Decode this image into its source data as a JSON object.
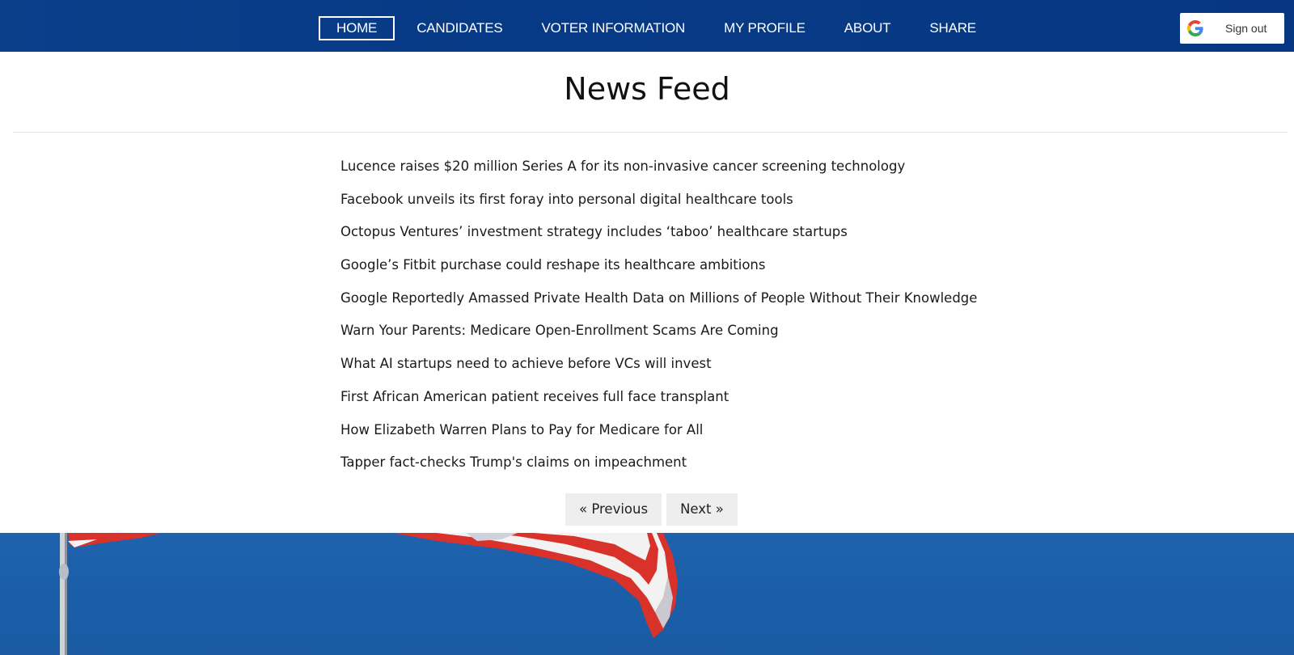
{
  "nav": {
    "items": [
      {
        "label": "HOME",
        "active": true
      },
      {
        "label": "CANDIDATES",
        "active": false
      },
      {
        "label": "VOTER INFORMATION",
        "active": false
      },
      {
        "label": "MY PROFILE",
        "active": false
      },
      {
        "label": "ABOUT",
        "active": false
      },
      {
        "label": "SHARE",
        "active": false
      }
    ],
    "signout": {
      "label": "Sign out",
      "icon": "google-icon"
    }
  },
  "main": {
    "title": "News Feed",
    "news": [
      "Lucence raises $20 million Series A for its non-invasive cancer screening technology",
      "Facebook unveils its first foray into personal digital healthcare tools",
      "Octopus Ventures’ investment strategy includes ‘taboo’ healthcare startups",
      "Google’s Fitbit purchase could reshape its healthcare ambitions",
      "Google Reportedly Amassed Private Health Data on Millions of People Without Their Knowledge",
      "Warn Your Parents: Medicare Open-Enrollment Scams Are Coming",
      "What AI startups need to achieve before VCs will invest",
      "First African American patient receives full face transplant",
      "How Elizabeth Warren Plans to Pay for Medicare for All",
      "Tapper fact-checks Trump's claims on impeachment"
    ],
    "pager": {
      "previous": "« Previous",
      "next": "Next »"
    }
  },
  "colors": {
    "navbar": "#073a86",
    "sky": "#1d5fa6",
    "flag_red": "#d9322a",
    "flag_white": "#f2f2f2"
  }
}
